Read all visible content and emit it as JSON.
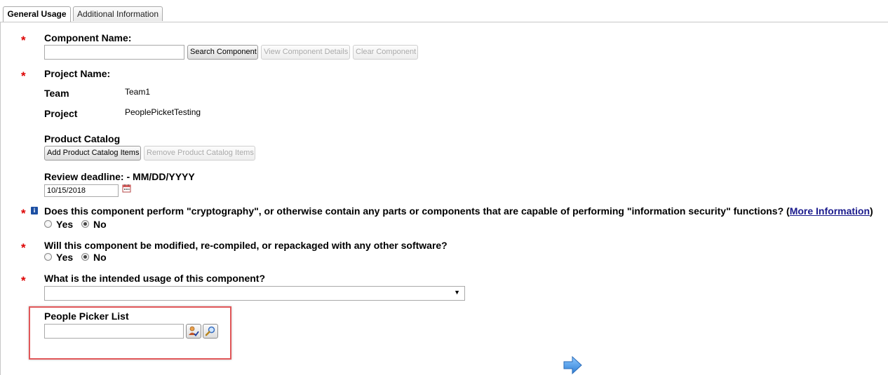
{
  "tabs": [
    {
      "label": "General Usage",
      "active": true
    },
    {
      "label": "Additional Information",
      "active": false
    }
  ],
  "required_marker": "*",
  "component": {
    "label": "Component Name:",
    "value": "",
    "search_button": "Search Component",
    "view_button": "View Component Details",
    "clear_button": "Clear Component"
  },
  "project": {
    "label": "Project Name:",
    "team_label": "Team",
    "team_value": "Team1",
    "project_label": "Project",
    "project_value": "PeoplePicketTesting"
  },
  "catalog": {
    "label": "Product Catalog",
    "add_button": "Add Product Catalog Items",
    "remove_button": "Remove Product Catalog Items"
  },
  "review": {
    "label": "Review deadline: - MM/DD/YYYY",
    "value": "10/15/2018"
  },
  "crypto": {
    "info_icon": "i",
    "question": "Does this component perform \"cryptography\", or otherwise contain any parts or components that are capable of performing \"information security\" functions? (",
    "link": "More Information",
    "close": ")",
    "yes_label": "Yes",
    "no_label": "No",
    "selected": "No"
  },
  "modified": {
    "question": "Will this component be modified, re-compiled, or repackaged with any other software?",
    "yes_label": "Yes",
    "no_label": "No",
    "selected": "No"
  },
  "usage": {
    "question": "What is the intended usage of this component?",
    "selected_value": ""
  },
  "people_picker": {
    "label": "People Picker List",
    "value": ""
  },
  "colors": {
    "required": "#dd0000",
    "highlight": "#e15759",
    "link": "#1a1a8c",
    "next_arrow": "#3a8fe0"
  }
}
